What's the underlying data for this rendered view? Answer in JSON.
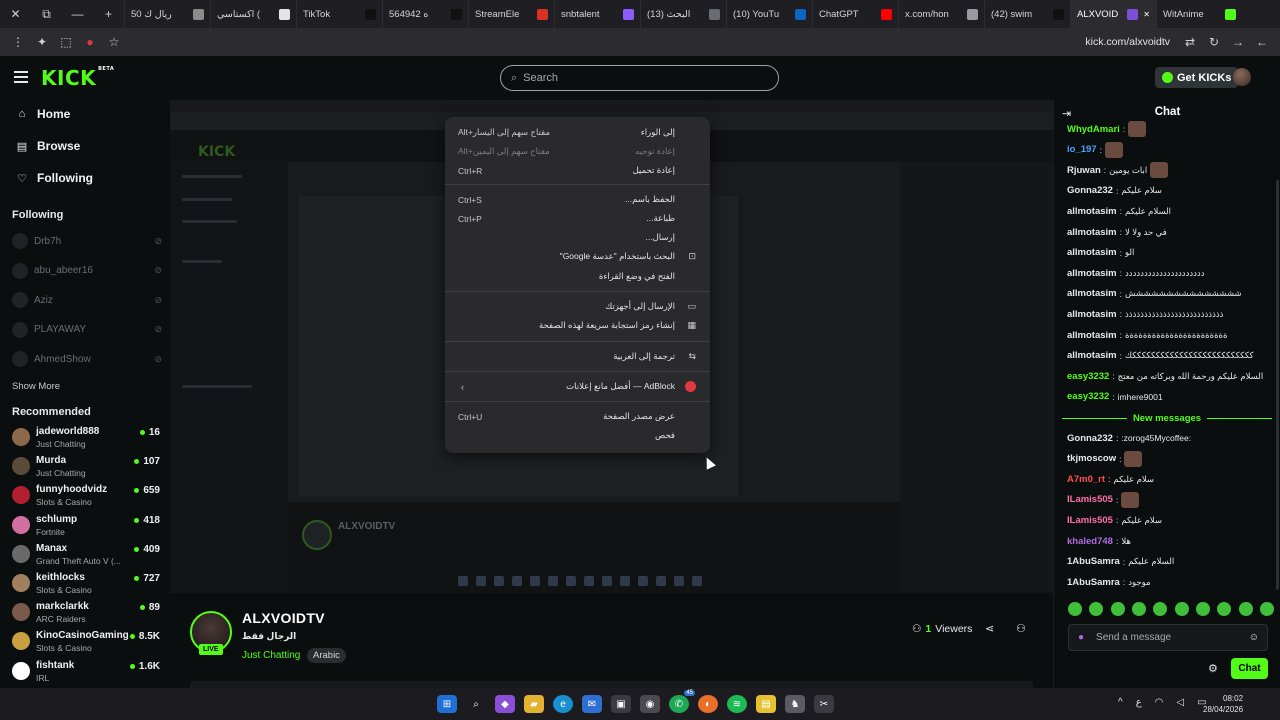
{
  "browser": {
    "tabs": [
      {
        "label": "50 ريال ك",
        "color": "#8a8a8a"
      },
      {
        "label": "اكستاسي (",
        "color": "#e4e4e8"
      },
      {
        "label": "TikTok",
        "color": "#111111"
      },
      {
        "label": "564942 ه",
        "color": "#111111"
      },
      {
        "label": "StreamEle",
        "color": "#d93025"
      },
      {
        "label": "snbtalent",
        "color": "#8c5cff"
      },
      {
        "label": "(13) البحث",
        "color": "#6b6b72"
      },
      {
        "label": "(10) YouTu",
        "color": "#0a66c2"
      },
      {
        "label": "ChatGPT",
        "color": "#ff0000"
      },
      {
        "label": "x.com/hon",
        "color": "#9a9aa0"
      },
      {
        "label": "(42) swim",
        "color": "#111111"
      },
      {
        "label": "ALXVOID",
        "color": "#7b4fd6"
      },
      {
        "label": "WitAnime",
        "color": "#53fc18"
      }
    ],
    "active_tab": "ALXVOID",
    "url": "kick.com/alxvoidtv"
  },
  "header": {
    "logo": "KICK",
    "logo_badge": "BETA",
    "search_placeholder": "Search",
    "get_kicks": "Get KICKs"
  },
  "sidebar": {
    "nav": [
      {
        "label": "Home",
        "icon": "home-icon"
      },
      {
        "label": "Browse",
        "icon": "browse-icon"
      },
      {
        "label": "Following",
        "icon": "heart-icon"
      }
    ],
    "following_title": "Following",
    "following": [
      "Drb7h",
      "abu_abeer16",
      "Aziz",
      "PLAYAWAY",
      "AhmedShow"
    ],
    "show_more": "Show More",
    "recommended_title": "Recommended",
    "recommended": [
      {
        "name": "jadeworld888",
        "category": "Just Chatting",
        "viewers": "16",
        "color": "#8a6a4a"
      },
      {
        "name": "Murda",
        "category": "Just Chatting",
        "viewers": "107",
        "color": "#5a4a3a"
      },
      {
        "name": "funnyhoodvidz",
        "category": "Slots & Casino",
        "viewers": "659",
        "color": "#b02030"
      },
      {
        "name": "schlump",
        "category": "Fortnite",
        "viewers": "418",
        "color": "#d070a0"
      },
      {
        "name": "Manax",
        "category": "Grand Theft Auto V (...",
        "viewers": "409",
        "color": "#6a6a6a"
      },
      {
        "name": "keithlocks",
        "category": "Slots & Casino",
        "viewers": "727",
        "color": "#a08060"
      },
      {
        "name": "markclarkk",
        "category": "ARC Raiders",
        "viewers": "89",
        "color": "#7a5a4a"
      },
      {
        "name": "KinoCasinoGaming",
        "category": "Slots & Casino",
        "viewers": "8.5K",
        "color": "#c8a040"
      },
      {
        "name": "fishtank",
        "category": "IRL",
        "viewers": "1.6K",
        "color": "#ffffff"
      }
    ]
  },
  "context_menu": {
    "items": [
      {
        "label": "إلى الوراء",
        "shortcut": "Alt+مفتاح سهم إلى اليسار",
        "disabled": false
      },
      {
        "label": "إعادة توجيه",
        "shortcut": "Alt+مفتاح سهم إلى اليمين",
        "disabled": true
      },
      {
        "label": "إعادة تحميل",
        "shortcut": "Ctrl+R",
        "disabled": false
      },
      {
        "label": "الحفظ باسم...",
        "shortcut": "Ctrl+S",
        "disabled": false
      },
      {
        "label": "طباعة...",
        "shortcut": "Ctrl+P",
        "disabled": false
      },
      {
        "label": "إرسال...",
        "shortcut": "",
        "disabled": false
      },
      {
        "label": "البحث باستخدام \"عدسة Google\"",
        "shortcut": "",
        "disabled": false
      },
      {
        "label": "الفتح في وضع القراءة",
        "shortcut": "",
        "disabled": false
      },
      {
        "label": "الإرسال إلى أجهزتك",
        "shortcut": "",
        "disabled": false
      },
      {
        "label": "إنشاء رمز استجابة سريعة لهذه الصفحة",
        "shortcut": "",
        "disabled": false
      },
      {
        "label": "ترجمة إلى العربية",
        "shortcut": "",
        "disabled": false
      },
      {
        "label": "AdBlock — أفضل مانع إعلانات",
        "shortcut": "",
        "disabled": false
      },
      {
        "label": "عرض مصدر الصفحة",
        "shortcut": "Ctrl+U",
        "disabled": false
      },
      {
        "label": "فحص",
        "shortcut": "",
        "disabled": false
      }
    ]
  },
  "stream": {
    "channel": "ALXVOIDTV",
    "title": "الرجال فقط",
    "category": "Just Chatting",
    "tag": "Arabic",
    "live_badge": "LIVE",
    "viewers_count": "1",
    "viewers_label": "Viewers"
  },
  "chat": {
    "title": "Chat",
    "messages": [
      {
        "user": "WhydAmari",
        "text": "",
        "color": "#53fc18",
        "emote": true
      },
      {
        "user": "io_197",
        "text": "",
        "color": "#4aa3ff",
        "emote": true
      },
      {
        "user": "Rjuwan",
        "text": "ابات يومين",
        "color": "#e8e8ea",
        "emote": true
      },
      {
        "user": "Gonna232",
        "text": "سلام عليكم",
        "color": "#e8e8ea",
        "emote": false
      },
      {
        "user": "allmotasim",
        "text": "السلام عليكم",
        "color": "#e8e8ea",
        "emote": false
      },
      {
        "user": "allmotasim",
        "text": "في حد ولا لا",
        "color": "#e8e8ea",
        "emote": false
      },
      {
        "user": "allmotasim",
        "text": "الو",
        "color": "#e8e8ea",
        "emote": false
      },
      {
        "user": "allmotasim",
        "text": "ددددددددددددددددددددد",
        "color": "#e8e8ea",
        "emote": false
      },
      {
        "user": "allmotasim",
        "text": "ششششششششششششششش",
        "color": "#e8e8ea",
        "emote": false
      },
      {
        "user": "allmotasim",
        "text": "ذذذذذذذذذذذذذذذذذذذذذذذذذذ",
        "color": "#e8e8ea",
        "emote": false
      },
      {
        "user": "allmotasim",
        "text": "ةةةةةةةةةةةةةةةةةةةةةةة",
        "color": "#e8e8ea",
        "emote": false
      },
      {
        "user": "allmotasim",
        "text": "ككككككككككككككككككككككككككك",
        "color": "#e8e8ea",
        "emote": false
      },
      {
        "user": "easy3232",
        "text": "السلام عليكم ورحمة الله وبركاته من معتج",
        "color": "#53fc18",
        "emote": false
      },
      {
        "user": "easy3232",
        "text": "imhere9001",
        "color": "#53fc18",
        "emote": false
      }
    ],
    "new_messages_label": "New messages",
    "new_messages": [
      {
        "user": "Gonna232",
        "text": ":zorog45Mycoffee:",
        "color": "#e8e8ea",
        "emote": false
      },
      {
        "user": "tkjmoscow",
        "text": "",
        "color": "#e8e8ea",
        "emote": true
      },
      {
        "user": "A7m0_rt",
        "text": "سلام عليكم",
        "color": "#ff4d4d",
        "emote": false
      },
      {
        "user": "ILamis505",
        "text": "",
        "color": "#ff6fa8",
        "emote": true
      },
      {
        "user": "ILamis505",
        "text": "سلام عليكم",
        "color": "#ff6fa8",
        "emote": false
      },
      {
        "user": "khaled748",
        "text": "هلا",
        "color": "#b06ae0",
        "emote": false
      },
      {
        "user": "1AbuSamra",
        "text": "السلام عليكم",
        "color": "#e8e8ea",
        "emote": false
      },
      {
        "user": "1AbuSamra",
        "text": "موجود",
        "color": "#e8e8ea",
        "emote": false
      }
    ],
    "input_placeholder": "Send a message",
    "send_label": "Chat"
  },
  "taskbar": {
    "tray_lang": "ع",
    "time": "08:02",
    "date": "28/04/2026",
    "whatsapp_badge": "45"
  }
}
